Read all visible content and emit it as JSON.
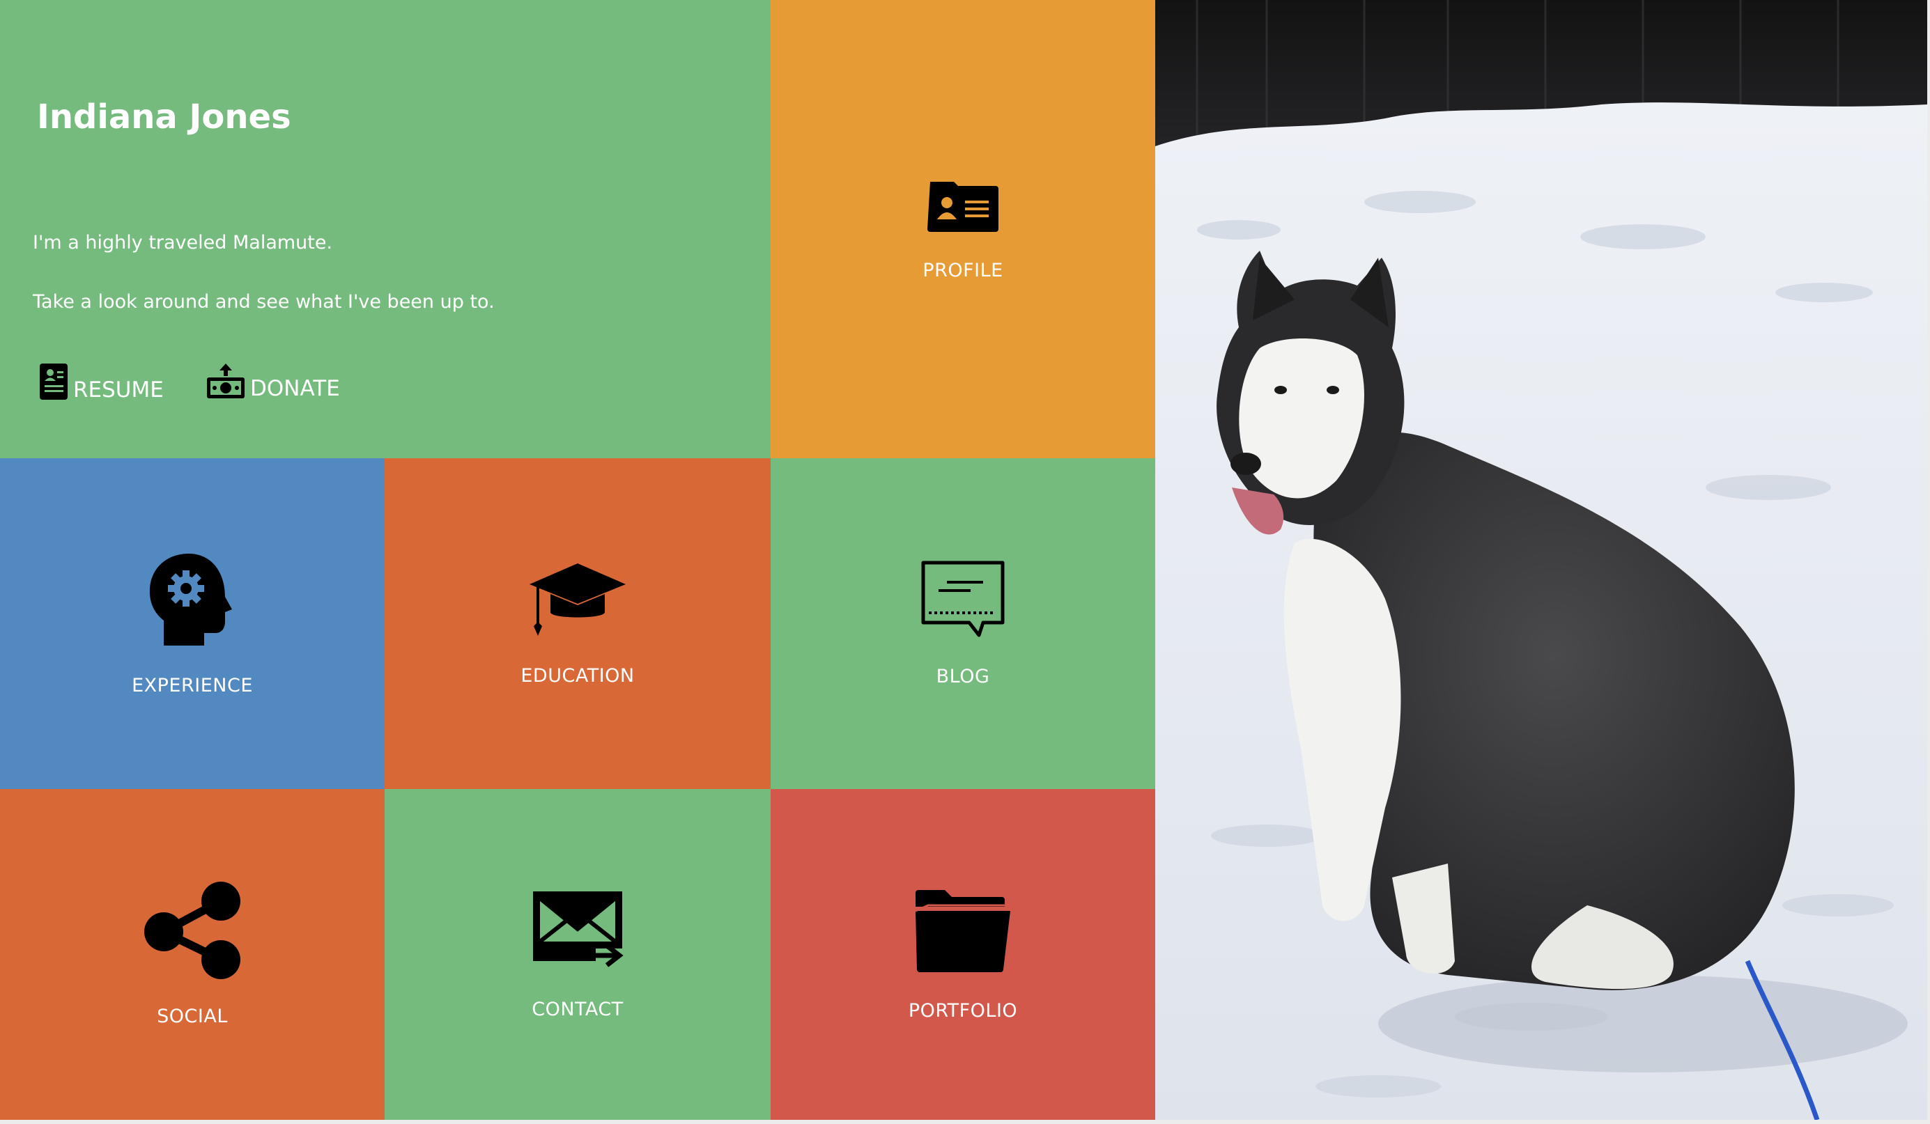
{
  "intro": {
    "name": "Indiana Jones",
    "line1": "I'm a highly traveled Malamute.",
    "line2": "Take a look around and see what I've been up to.",
    "resume_label": "RESUME",
    "donate_label": "DONATE",
    "bg_color": "#75bb7e"
  },
  "tiles": [
    {
      "key": "profile",
      "label": "PROFILE",
      "icon": "id-card-icon",
      "color": "#e69b35"
    },
    {
      "key": "experience",
      "label": "EXPERIENCE",
      "icon": "head-gear-icon",
      "color": "#5389c1"
    },
    {
      "key": "education",
      "label": "EDUCATION",
      "icon": "graduation-cap-icon",
      "color": "#d96837"
    },
    {
      "key": "blog",
      "label": "BLOG",
      "icon": "speech-bubble-icon",
      "color": "#75bb7e"
    },
    {
      "key": "social",
      "label": "SOCIAL",
      "icon": "share-icon",
      "color": "#d96837"
    },
    {
      "key": "contact",
      "label": "CONTACT",
      "icon": "envelope-arrow-icon",
      "color": "#75bb7e"
    },
    {
      "key": "portfolio",
      "label": "PORTFOLIO",
      "icon": "folder-icon",
      "color": "#d2584c"
    }
  ],
  "photo": {
    "subject": "Alaskan Malamute sitting in snow",
    "icon": "dog-photo"
  }
}
